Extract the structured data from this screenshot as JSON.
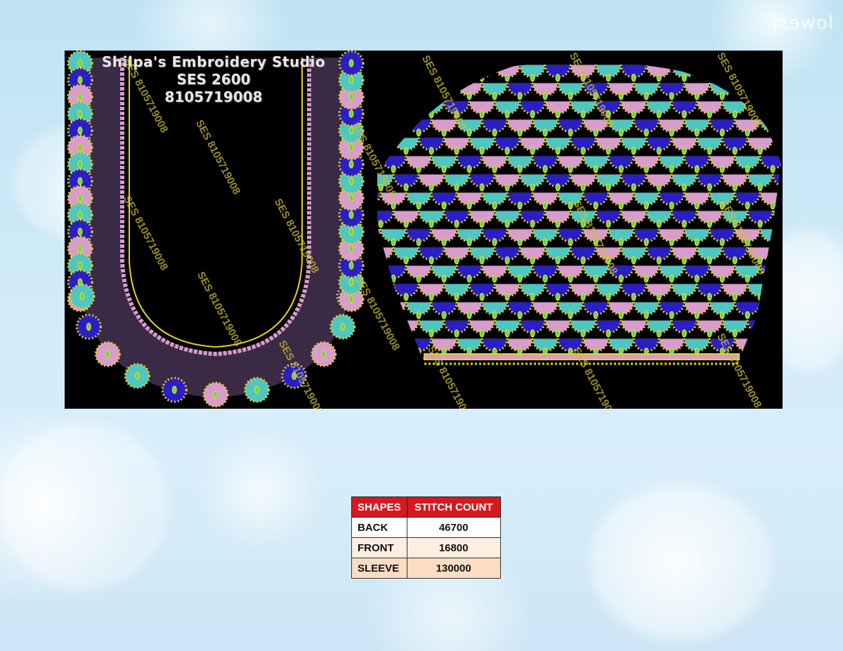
{
  "studio": {
    "name": "Shilpa's Embroidery Studio",
    "code": "SES 2600",
    "phone": "8105719008"
  },
  "watermark": "SES 8105719008",
  "corner_logo": "lowesi",
  "colors": {
    "royal_blue": "#2a1fc4",
    "aqua": "#4fc6c0",
    "pink": "#d89ccd",
    "gold": "#e6d21a",
    "green": "#46e06a",
    "header_red": "#d7191f"
  },
  "table": {
    "headers": [
      "SHAPES",
      "STITCH COUNT"
    ],
    "rows": [
      {
        "shape": "BACK",
        "count": "46700"
      },
      {
        "shape": "FRONT",
        "count": "16800"
      },
      {
        "shape": "SLEEVE",
        "count": "130000"
      }
    ]
  }
}
